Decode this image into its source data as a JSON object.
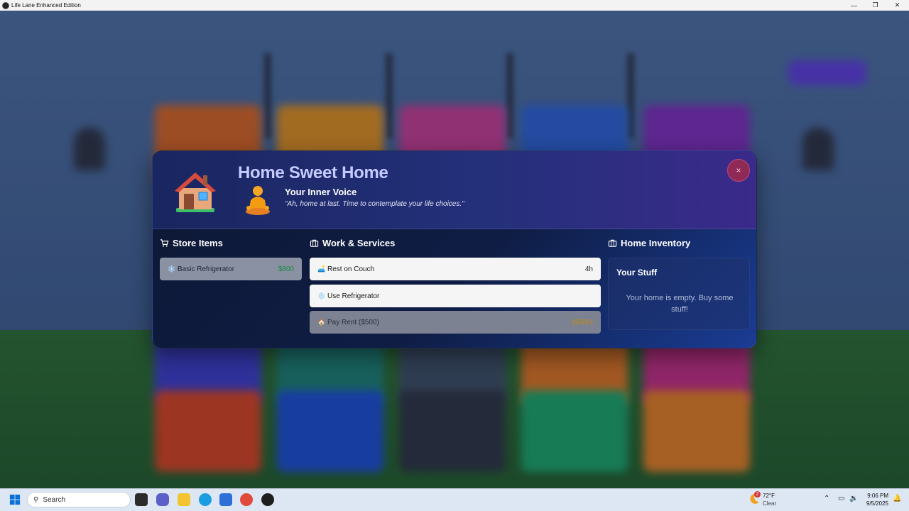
{
  "window": {
    "title": "Life Lane Enhanced Edition",
    "minimize": "—",
    "maximize": "❐",
    "close": "✕"
  },
  "modal": {
    "title": "Home Sweet Home",
    "close_label": "×",
    "voice_title": "Your Inner Voice",
    "voice_quote": "\"Ah, home at last. Time to contemplate your life choices.\""
  },
  "store": {
    "heading": "Store Items",
    "items": [
      {
        "icon": "❄️",
        "label": "Basic Refrigerator",
        "price": "$800"
      }
    ]
  },
  "work": {
    "heading": "Work & Services",
    "items": [
      {
        "icon": "🛋️",
        "label": "Rest on Couch",
        "value": "4h"
      },
      {
        "icon": "❄️",
        "label": "Use Refrigerator",
        "value": ""
      },
      {
        "icon": "🏠",
        "label": "Pay Rent ($500)",
        "value": "($500)"
      }
    ]
  },
  "inventory": {
    "heading": "Home Inventory",
    "box_title": "Your Stuff",
    "empty_text": "Your home is empty. Buy some stuff!"
  },
  "taskbar": {
    "search_placeholder": "Search",
    "weather_temp": "72°F",
    "weather_cond": "Clear",
    "weather_badge": "2",
    "time": "9:06 PM",
    "date": "9/5/2025"
  },
  "colors": {
    "accent_title": "#c6cbff",
    "price_green": "#1d8a4a",
    "rent_amber": "#c48a12",
    "close_pink": "#8e2a55"
  }
}
